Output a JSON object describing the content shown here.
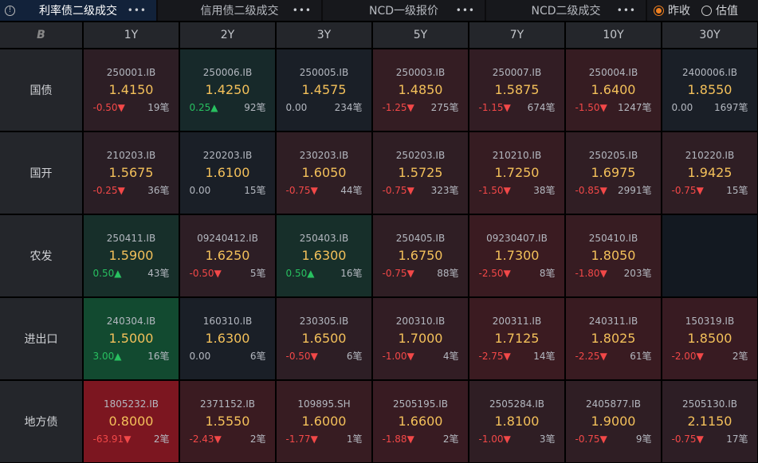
{
  "tabs": [
    {
      "label": "利率债二级成交",
      "active": true
    },
    {
      "label": "信用债二级成交",
      "active": false
    },
    {
      "label": "NCD一级报价",
      "active": false
    },
    {
      "label": "NCD二级成交",
      "active": false
    }
  ],
  "more_label": "•••",
  "info_glyph": "!",
  "radios": [
    {
      "label": "昨收",
      "checked": true
    },
    {
      "label": "估值",
      "checked": false
    }
  ],
  "corner_icon": "B",
  "columns": [
    "1Y",
    "2Y",
    "3Y",
    "5Y",
    "7Y",
    "10Y",
    "30Y"
  ],
  "count_suffix": "笔",
  "rows": [
    {
      "label": "国债",
      "cells": [
        {
          "code": "250001.IB",
          "yield": "1.4150",
          "change": "-0.50",
          "count": "19",
          "bg": "#2d1e25"
        },
        {
          "code": "250006.IB",
          "yield": "1.4250",
          "change": "0.25",
          "count": "92",
          "bg": "#17292a"
        },
        {
          "code": "250005.IB",
          "yield": "1.4575",
          "change": "0.00",
          "count": "234",
          "bg": "#1a1f27"
        },
        {
          "code": "250003.IB",
          "yield": "1.4850",
          "change": "-1.25",
          "count": "275",
          "bg": "#341d23"
        },
        {
          "code": "250007.IB",
          "yield": "1.5875",
          "change": "-1.15",
          "count": "674",
          "bg": "#321d24"
        },
        {
          "code": "250004.IB",
          "yield": "1.6400",
          "change": "-1.50",
          "count": "1247",
          "bg": "#361c22"
        },
        {
          "code": "2400006.IB",
          "yield": "1.8550",
          "change": "0.00",
          "count": "1697",
          "bg": "#1a1f27"
        }
      ]
    },
    {
      "label": "国开",
      "cells": [
        {
          "code": "210203.IB",
          "yield": "1.5675",
          "change": "-0.25",
          "count": "36",
          "bg": "#2a1e25"
        },
        {
          "code": "220203.IB",
          "yield": "1.6100",
          "change": "0.00",
          "count": "15",
          "bg": "#1a1f27"
        },
        {
          "code": "230203.IB",
          "yield": "1.6050",
          "change": "-0.75",
          "count": "44",
          "bg": "#2f1e24"
        },
        {
          "code": "250203.IB",
          "yield": "1.5725",
          "change": "-0.75",
          "count": "323",
          "bg": "#2f1e24"
        },
        {
          "code": "210210.IB",
          "yield": "1.7250",
          "change": "-1.50",
          "count": "38",
          "bg": "#361c22"
        },
        {
          "code": "250205.IB",
          "yield": "1.6975",
          "change": "-0.85",
          "count": "2991",
          "bg": "#301e24"
        },
        {
          "code": "210220.IB",
          "yield": "1.9425",
          "change": "-0.75",
          "count": "15",
          "bg": "#2f1e24"
        }
      ]
    },
    {
      "label": "农发",
      "cells": [
        {
          "code": "250411.IB",
          "yield": "1.5900",
          "change": "0.50",
          "count": "43",
          "bg": "#172f2a"
        },
        {
          "code": "09240412.IB",
          "yield": "1.6250",
          "change": "-0.50",
          "count": "5",
          "bg": "#2d1e25"
        },
        {
          "code": "250403.IB",
          "yield": "1.6300",
          "change": "0.50",
          "count": "16",
          "bg": "#172f2a"
        },
        {
          "code": "250405.IB",
          "yield": "1.6750",
          "change": "-0.75",
          "count": "88",
          "bg": "#2f1e24"
        },
        {
          "code": "09230407.IB",
          "yield": "1.7300",
          "change": "-2.50",
          "count": "8",
          "bg": "#3a1b21"
        },
        {
          "code": "250410.IB",
          "yield": "1.8050",
          "change": "-1.80",
          "count": "203",
          "bg": "#371c22"
        },
        null
      ]
    },
    {
      "label": "进出口",
      "cells": [
        {
          "code": "240304.IB",
          "yield": "1.5000",
          "change": "3.00",
          "count": "16",
          "bg": "#124a30"
        },
        {
          "code": "160310.IB",
          "yield": "1.6300",
          "change": "0.00",
          "count": "6",
          "bg": "#1a1f27"
        },
        {
          "code": "230305.IB",
          "yield": "1.6500",
          "change": "-0.50",
          "count": "6",
          "bg": "#2d1e25"
        },
        {
          "code": "200310.IB",
          "yield": "1.7000",
          "change": "-1.00",
          "count": "4",
          "bg": "#321d24"
        },
        {
          "code": "200311.IB",
          "yield": "1.7125",
          "change": "-2.75",
          "count": "14",
          "bg": "#3b1b21"
        },
        {
          "code": "240311.IB",
          "yield": "1.8025",
          "change": "-2.25",
          "count": "61",
          "bg": "#391b21"
        },
        {
          "code": "150319.IB",
          "yield": "1.8500",
          "change": "-2.00",
          "count": "2",
          "bg": "#381b22"
        }
      ]
    },
    {
      "label": "地方债",
      "cells": [
        {
          "code": "1805232.IB",
          "yield": "0.8000",
          "change": "-63.91",
          "count": "2",
          "bg": "#7c1620"
        },
        {
          "code": "2371152.IB",
          "yield": "1.5550",
          "change": "-2.43",
          "count": "2",
          "bg": "#3a1b21"
        },
        {
          "code": "109895.SH",
          "yield": "1.6000",
          "change": "-1.77",
          "count": "1",
          "bg": "#371c22"
        },
        {
          "code": "2505195.IB",
          "yield": "1.6600",
          "change": "-1.88",
          "count": "2",
          "bg": "#381b22"
        },
        {
          "code": "2505284.IB",
          "yield": "1.8100",
          "change": "-1.00",
          "count": "3",
          "bg": "#2f1e24"
        },
        {
          "code": "2405877.IB",
          "yield": "1.9000",
          "change": "-0.75",
          "count": "9",
          "bg": "#2f1e24"
        },
        {
          "code": "2505130.IB",
          "yield": "2.1150",
          "change": "-0.75",
          "count": "17",
          "bg": "#2d1e25"
        }
      ]
    }
  ],
  "empty_bg": "#131921"
}
